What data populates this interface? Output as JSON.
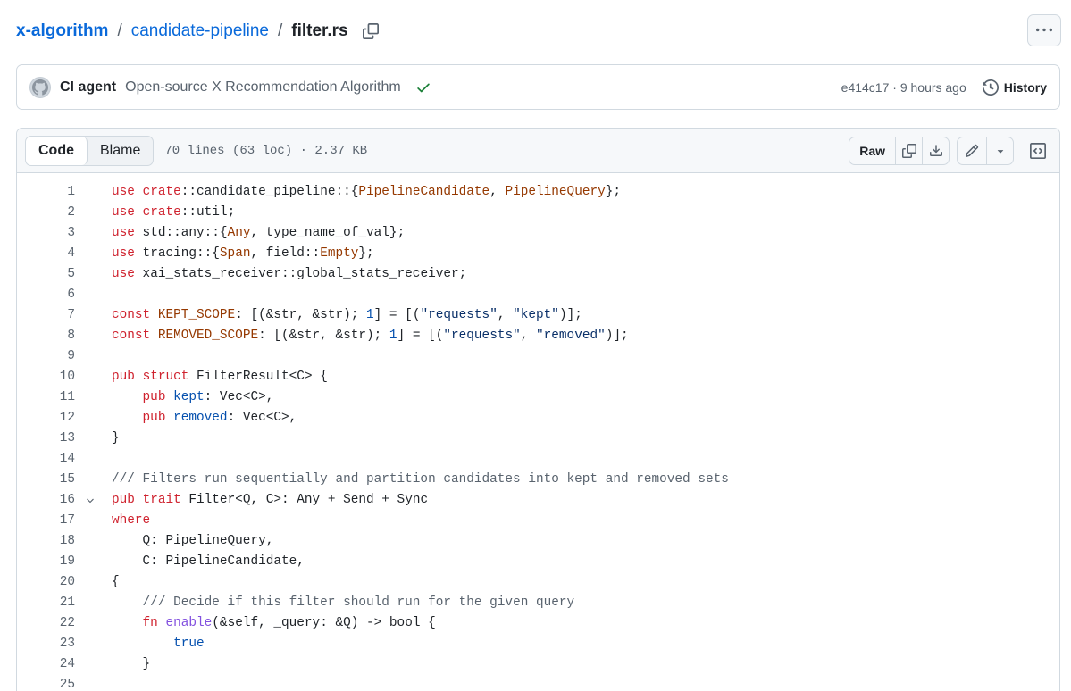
{
  "breadcrumb": {
    "repo": "x-algorithm",
    "folder": "candidate-pipeline",
    "file": "filter.rs",
    "sep": "/"
  },
  "commit": {
    "author": "CI agent",
    "message": "Open-source X Recommendation Algorithm",
    "sha_time": "e414c17 · 9 hours ago",
    "history_label": "History"
  },
  "file_header": {
    "tab_code": "Code",
    "tab_blame": "Blame",
    "info": "70 lines (63 loc) · 2.37 KB",
    "raw_label": "Raw"
  },
  "colors": {
    "link": "#0969da",
    "keyword": "#cf222e",
    "function": "#8250df",
    "type": "#953800",
    "string": "#0a3069",
    "constant": "#0550ae",
    "comment": "#59636e",
    "success": "#1a7f37"
  },
  "icons": [
    "copy-icon",
    "kebab-horizontal-icon",
    "github-avatar-icon",
    "check-icon",
    "history-icon",
    "download-icon",
    "pencil-icon",
    "triangle-down-icon",
    "code-square-icon",
    "chevron-down-icon"
  ],
  "code_lines": [
    {
      "n": "1",
      "tokens": [
        [
          "kw",
          "use"
        ],
        [
          "",
          " "
        ],
        [
          "kw",
          "crate"
        ],
        [
          "",
          "::candidate_pipeline::{"
        ],
        [
          "ty",
          "PipelineCandidate"
        ],
        [
          "",
          ", "
        ],
        [
          "ty",
          "PipelineQuery"
        ],
        [
          "",
          "};"
        ]
      ]
    },
    {
      "n": "2",
      "tokens": [
        [
          "kw",
          "use"
        ],
        [
          "",
          " "
        ],
        [
          "kw",
          "crate"
        ],
        [
          "",
          "::util;"
        ]
      ]
    },
    {
      "n": "3",
      "tokens": [
        [
          "kw",
          "use"
        ],
        [
          "",
          " std::any::{"
        ],
        [
          "ty",
          "Any"
        ],
        [
          "",
          ", type_name_of_val};"
        ]
      ]
    },
    {
      "n": "4",
      "tokens": [
        [
          "kw",
          "use"
        ],
        [
          "",
          " tracing::{"
        ],
        [
          "ty",
          "Span"
        ],
        [
          "",
          ", field::"
        ],
        [
          "ty",
          "Empty"
        ],
        [
          "",
          "};"
        ]
      ]
    },
    {
      "n": "5",
      "tokens": [
        [
          "kw",
          "use"
        ],
        [
          "",
          " xai_stats_receiver::global_stats_receiver;"
        ]
      ]
    },
    {
      "n": "6",
      "tokens": []
    },
    {
      "n": "7",
      "tokens": [
        [
          "kw",
          "const"
        ],
        [
          "",
          " "
        ],
        [
          "ty",
          "KEPT_SCOPE"
        ],
        [
          "",
          ": [(&str, &str); "
        ],
        [
          "num",
          "1"
        ],
        [
          "",
          "] = [("
        ],
        [
          "str",
          "\"requests\""
        ],
        [
          "",
          ", "
        ],
        [
          "str",
          "\"kept\""
        ],
        [
          "",
          ")];"
        ]
      ]
    },
    {
      "n": "8",
      "tokens": [
        [
          "kw",
          "const"
        ],
        [
          "",
          " "
        ],
        [
          "ty",
          "REMOVED_SCOPE"
        ],
        [
          "",
          ": [(&str, &str); "
        ],
        [
          "num",
          "1"
        ],
        [
          "",
          "] = [("
        ],
        [
          "str",
          "\"requests\""
        ],
        [
          "",
          ", "
        ],
        [
          "str",
          "\"removed\""
        ],
        [
          "",
          ")];"
        ]
      ]
    },
    {
      "n": "9",
      "tokens": []
    },
    {
      "n": "10",
      "tokens": [
        [
          "kw",
          "pub"
        ],
        [
          "",
          " "
        ],
        [
          "kw",
          "struct"
        ],
        [
          "",
          " FilterResult<C> {"
        ]
      ]
    },
    {
      "n": "11",
      "tokens": [
        [
          "",
          "    "
        ],
        [
          "kw",
          "pub"
        ],
        [
          "",
          " "
        ],
        [
          "bl",
          "kept"
        ],
        [
          "",
          ": Vec<C>,"
        ]
      ]
    },
    {
      "n": "12",
      "tokens": [
        [
          "",
          "    "
        ],
        [
          "kw",
          "pub"
        ],
        [
          "",
          " "
        ],
        [
          "bl",
          "removed"
        ],
        [
          "",
          ": Vec<C>,"
        ]
      ]
    },
    {
      "n": "13",
      "tokens": [
        [
          "",
          "}"
        ]
      ]
    },
    {
      "n": "14",
      "tokens": []
    },
    {
      "n": "15",
      "tokens": [
        [
          "cm",
          "/// Filters run sequentially and partition candidates into kept and removed sets"
        ]
      ]
    },
    {
      "n": "16",
      "fold": true,
      "tokens": [
        [
          "kw",
          "pub"
        ],
        [
          "",
          " "
        ],
        [
          "kw",
          "trait"
        ],
        [
          "",
          " Filter<Q, C>: Any + Send + Sync"
        ]
      ]
    },
    {
      "n": "17",
      "tokens": [
        [
          "kw",
          "where"
        ]
      ]
    },
    {
      "n": "18",
      "tokens": [
        [
          "",
          "    Q: PipelineQuery,"
        ]
      ]
    },
    {
      "n": "19",
      "tokens": [
        [
          "",
          "    C: PipelineCandidate,"
        ]
      ]
    },
    {
      "n": "20",
      "tokens": [
        [
          "",
          "{"
        ]
      ]
    },
    {
      "n": "21",
      "tokens": [
        [
          "",
          "    "
        ],
        [
          "cm",
          "/// Decide if this filter should run for the given query"
        ]
      ]
    },
    {
      "n": "22",
      "tokens": [
        [
          "",
          "    "
        ],
        [
          "kw",
          "fn"
        ],
        [
          "",
          " "
        ],
        [
          "fn",
          "enable"
        ],
        [
          "",
          "(&self, _query: &Q) -> bool {"
        ]
      ]
    },
    {
      "n": "23",
      "tokens": [
        [
          "",
          "        "
        ],
        [
          "bl",
          "true"
        ]
      ]
    },
    {
      "n": "24",
      "tokens": [
        [
          "",
          "    }"
        ]
      ]
    },
    {
      "n": "25",
      "tokens": []
    }
  ]
}
